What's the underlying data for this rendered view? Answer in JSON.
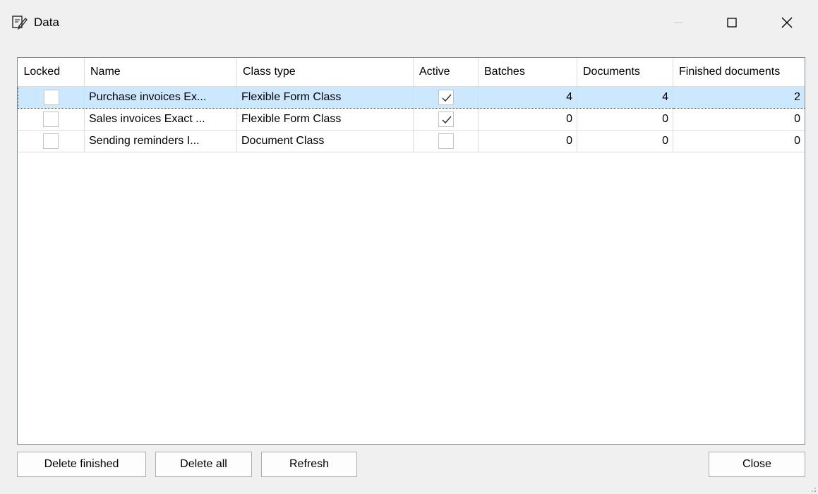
{
  "window": {
    "title": "Data",
    "icon": "data-document-icon",
    "controls": [
      "minimize-icon",
      "maximize-icon",
      "close-icon"
    ]
  },
  "grid": {
    "columns": [
      "Locked",
      "Name",
      "Class type",
      "Active",
      "Batches",
      "Documents",
      "Finished documents"
    ],
    "rows": [
      {
        "locked": false,
        "name": "Purchase invoices Ex...",
        "class_type": "Flexible Form Class",
        "active": true,
        "batches": "4",
        "documents": "4",
        "finished": "2",
        "selected": true
      },
      {
        "locked": false,
        "name": "Sales invoices Exact ...",
        "class_type": "Flexible Form Class",
        "active": true,
        "batches": "0",
        "documents": "0",
        "finished": "0",
        "selected": false
      },
      {
        "locked": false,
        "name": "Sending reminders I...",
        "class_type": "Document Class",
        "active": false,
        "batches": "0",
        "documents": "0",
        "finished": "0",
        "selected": false
      }
    ]
  },
  "buttons": {
    "delete_finished": "Delete finished",
    "delete_all": "Delete all",
    "refresh": "Refresh",
    "close": "Close"
  },
  "colors": {
    "selection": "#cce8ff",
    "background": "#f0f0f0"
  }
}
